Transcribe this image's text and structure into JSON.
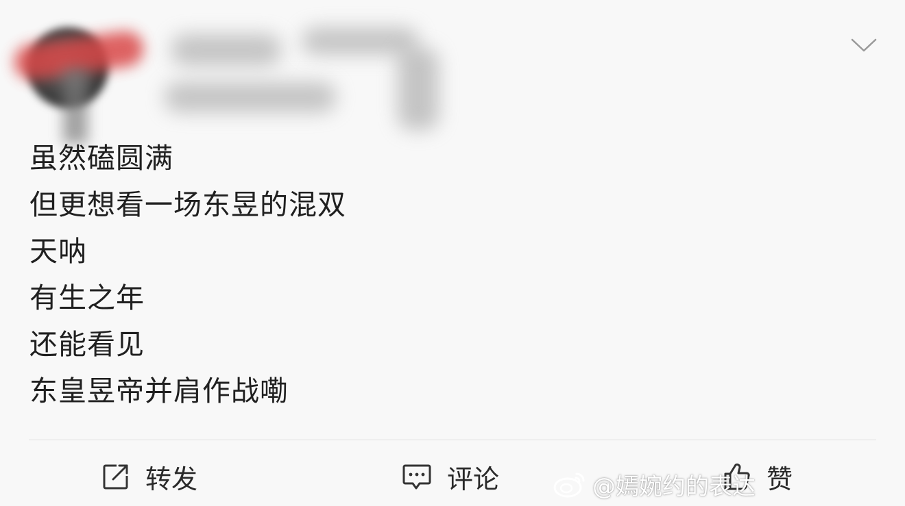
{
  "post": {
    "lines": [
      "虽然磕圆满",
      "但更想看一场东昱的混双",
      "天呐",
      "有生之年",
      "还能看见",
      "东皇昱帝并肩作战嘞"
    ]
  },
  "actions": {
    "repost_label": "转发",
    "comment_label": "评论",
    "like_label": "赞"
  },
  "watermark": {
    "text": "@嫣婉约的表达"
  },
  "icons": {
    "dropdown": "chevron-down-icon",
    "repost": "share-square-icon",
    "comment": "comment-bubble-icon",
    "like": "thumbs-up-icon",
    "weibo": "weibo-logo-icon"
  },
  "colors": {
    "background": "#f8f8f8",
    "text": "#202020",
    "divider": "#dedede"
  }
}
